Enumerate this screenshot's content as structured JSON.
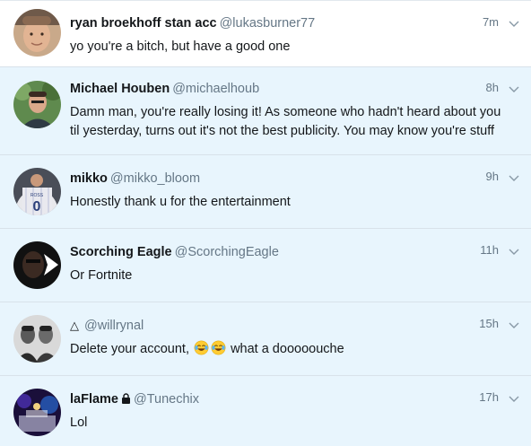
{
  "tweets": [
    {
      "name": "ryan broekhoff stan acc",
      "handle": "@lukasburner77",
      "time": "7m",
      "text": "yo you're a bitch, but have a good one",
      "state": "read",
      "avatar": "avatar-ryan"
    },
    {
      "name": "Michael Houben",
      "handle": "@michaelhoub",
      "time": "8h",
      "text": "Damn man, you're really losing it! As someone who hadn't heard about you til yesterday, turns out it's not the best publicity. You may know you're stuff",
      "state": "unread",
      "avatar": "avatar-michael"
    },
    {
      "name": "mikko",
      "handle": "@mikko_bloom",
      "time": "9h",
      "text": "Honestly thank u for the entertainment",
      "state": "unread",
      "avatar": "avatar-mikko"
    },
    {
      "name": "Scorching Eagle",
      "handle": "@ScorchingEagle",
      "time": "11h",
      "text": "Or Fortnite",
      "state": "unread",
      "avatar": "avatar-scorching"
    },
    {
      "name": "△",
      "handle": "@willrynal",
      "time": "15h",
      "text_before": "Delete your account,",
      "text_after": "what a dooooouche",
      "emoji": "face-with-tears-of-joy-emoji",
      "state": "unread",
      "avatar": "avatar-willrynal"
    },
    {
      "name": "laFlame",
      "handle": "@Tunechix",
      "time": "17h",
      "text": "Lol",
      "state": "unread",
      "avatar": "avatar-laflame",
      "protected_icon": "lock-icon"
    }
  ],
  "icons": {
    "chevron": "chevron-down-icon",
    "lock": "lock-icon",
    "emoji": "face-with-tears-of-joy-emoji"
  },
  "colors": {
    "unread_background": "#e8f5fd",
    "read_background": "#ffffff",
    "handle_gray": "#657786",
    "text_dark": "#14171a",
    "divider": "#d8e2ea"
  }
}
